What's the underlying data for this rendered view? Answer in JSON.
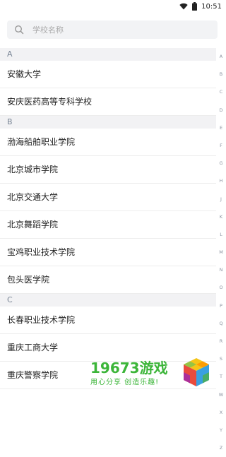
{
  "status_bar": {
    "time": "10:51",
    "icons": [
      "wifi-icon",
      "battery-icon"
    ]
  },
  "search": {
    "placeholder": "学校名称"
  },
  "sections": [
    {
      "letter": "A",
      "items": [
        "安徽大学",
        "安庆医药高等专科学校"
      ]
    },
    {
      "letter": "B",
      "items": [
        "渤海船舶职业学院",
        "北京城市学院",
        "北京交通大学",
        "北京舞蹈学院",
        "宝鸡职业技术学院",
        "包头医学院"
      ]
    },
    {
      "letter": "C",
      "items": [
        "长春职业技术学院",
        "重庆工商大学",
        "重庆警察学院"
      ]
    }
  ],
  "index_letters": [
    "A",
    "B",
    "C",
    "D",
    "E",
    "F",
    "G",
    "H",
    "J",
    "K",
    "L",
    "M",
    "N",
    "O",
    "P",
    "Q",
    "R",
    "S",
    "T",
    "W",
    "X",
    "Y",
    "Z"
  ],
  "watermark": {
    "title_num": "19673",
    "title_cn": "游戏",
    "slogan": "用心分享 创造乐趣!"
  },
  "colors": {
    "accent": "#3cb539",
    "section_bg": "#f2f2f4",
    "index_text": "#8a93a0"
  }
}
